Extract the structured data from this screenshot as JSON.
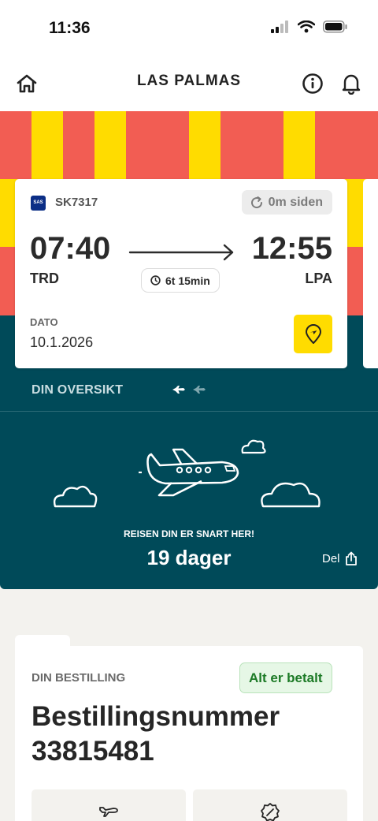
{
  "status_bar": {
    "time": "11:36"
  },
  "header": {
    "title": "LAS PALMAS"
  },
  "banner": {
    "colors": {
      "red": "#f25d53",
      "yellow": "#ffdc00",
      "teal": "#004a59"
    }
  },
  "flight": {
    "airline_logo": "SAS",
    "number": "SK7317",
    "updated": "0m siden",
    "departure_time": "07:40",
    "arrival_time": "12:55",
    "departure_code": "TRD",
    "arrival_code": "LPA",
    "duration": "6t 15min",
    "date_label": "DATO",
    "date_value": "10.1.2026"
  },
  "overview": {
    "label": "DIN OVERSIKT",
    "soon_text": "REISEN DIN ER SNART HER!",
    "countdown": "19 dager",
    "share_label": "Del"
  },
  "booking": {
    "label": "DIN BESTILLING",
    "status": "Alt er betalt",
    "title": "Bestillingsnummer",
    "number": "33815481"
  },
  "icons": [
    "home-icon",
    "info-icon",
    "bell-icon",
    "refresh-icon",
    "clock-icon",
    "arrow-right-icon",
    "map-pin-plane-icon",
    "plane-icon",
    "cloud-icon",
    "share-icon"
  ]
}
